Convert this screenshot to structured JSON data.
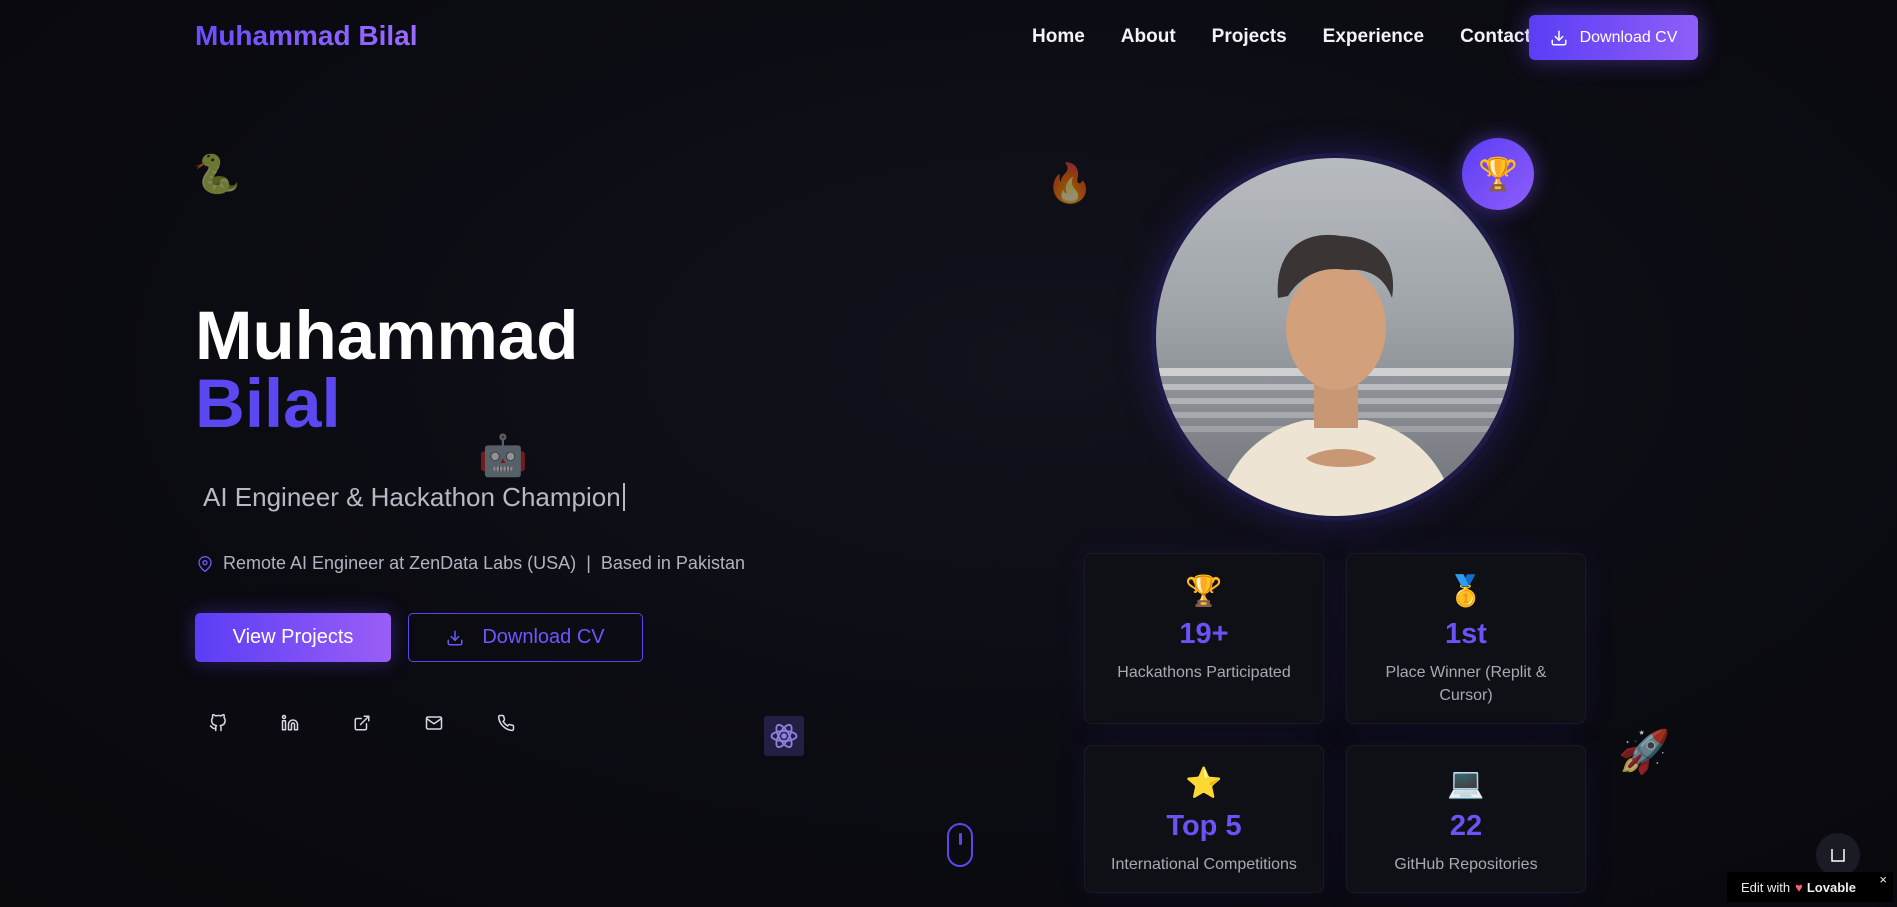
{
  "header": {
    "brand": "Muhammad Bilal",
    "nav": [
      "Home",
      "About",
      "Projects",
      "Experience",
      "Contact"
    ],
    "download_cv": "Download CV"
  },
  "hero": {
    "first_name": "Muhammad",
    "last_name": "Bilal",
    "subtitle": "AI Engineer & Hackathon Champion",
    "location_role": "Remote AI Engineer at ZenData Labs (USA)",
    "location_separator": "|",
    "location_place": "Based in Pakistan",
    "primary_button": "View Projects",
    "secondary_button": "Download CV",
    "socials": [
      "github-icon",
      "linkedin-icon",
      "external-link-icon",
      "mail-icon",
      "phone-icon"
    ]
  },
  "stats": [
    {
      "icon": "🏆",
      "value": "19+",
      "label": "Hackathons Participated"
    },
    {
      "icon": "🥇",
      "value": "1st",
      "label": "Place Winner (Replit & Cursor)"
    },
    {
      "icon": "⭐",
      "value": "Top 5",
      "label": "International Competitions"
    },
    {
      "icon": "💻",
      "value": "22",
      "label": "GitHub Repositories"
    }
  ],
  "badge": {
    "trophy_emoji": "🏆"
  },
  "lovable": {
    "prefix": "Edit with",
    "brand": "Lovable",
    "close": "×"
  },
  "colors": {
    "accent": "#5b3df5",
    "accent2": "#9a5ef6",
    "background": "#0b0b12"
  }
}
